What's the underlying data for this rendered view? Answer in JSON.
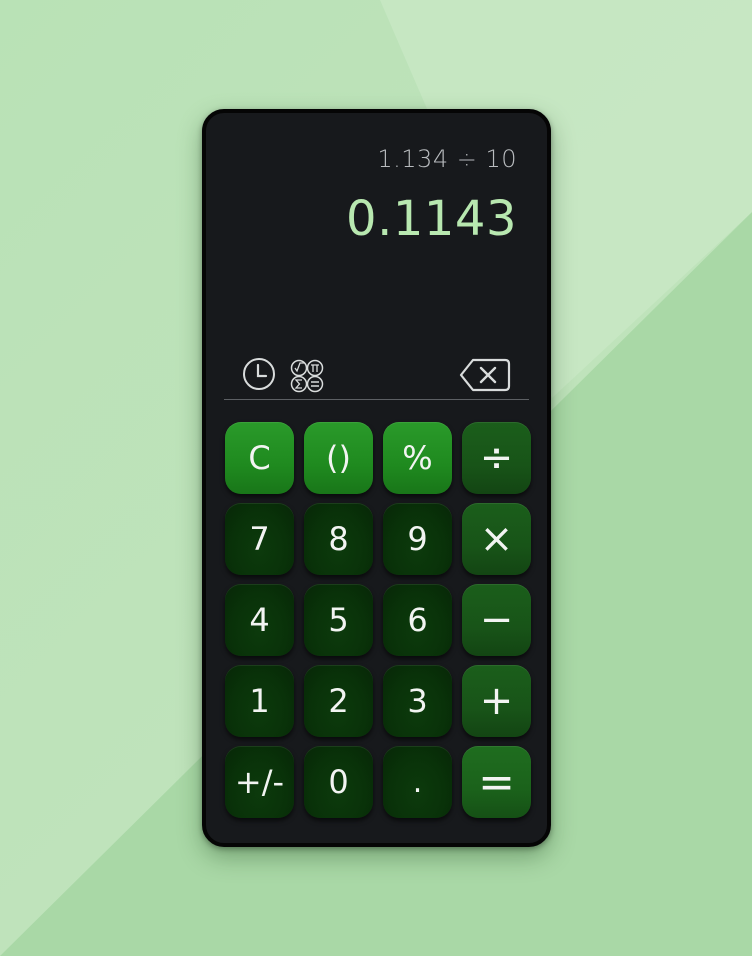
{
  "display": {
    "expression": "1.134 ÷ 10",
    "result": "0.1143"
  },
  "toolbar": {
    "history_icon": "clock-icon",
    "scientific_icon": "scientific-functions-icon",
    "backspace_icon": "backspace-icon"
  },
  "keys": {
    "clear": "C",
    "parentheses": "()",
    "percent": "%",
    "divide": "÷",
    "seven": "7",
    "eight": "8",
    "nine": "9",
    "multiply": "×",
    "four": "4",
    "five": "5",
    "six": "6",
    "minus": "−",
    "one": "1",
    "two": "2",
    "three": "3",
    "plus": "+",
    "negate": "+/-",
    "zero": "0",
    "decimal": ".",
    "equals": "="
  },
  "colors": {
    "background": "#a9d8a6",
    "device": "#17191c",
    "result_text": "#b8e8b0",
    "function_key": "#229222",
    "operator_key": "#185418",
    "number_key": "#093209"
  }
}
